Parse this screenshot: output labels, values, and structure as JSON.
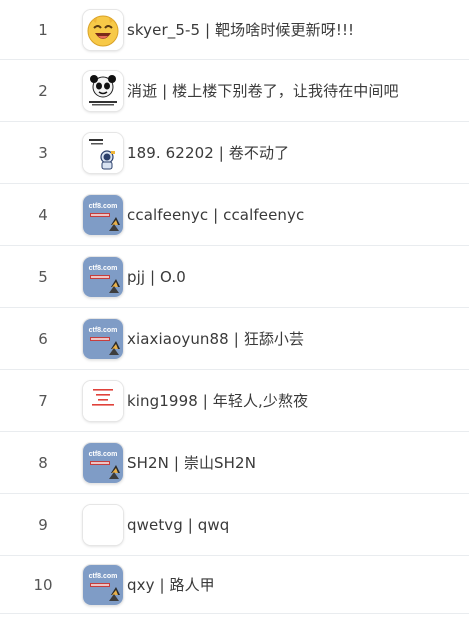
{
  "leaderboard": {
    "rows": [
      {
        "rank": "1",
        "entry": "skyer_5-5 | 靶场啥时候更新呀!!!",
        "avatar": "laughing-emoji-icon"
      },
      {
        "rank": "2",
        "entry": "消逝 | 楼上楼下别卷了，让我待在中间吧",
        "avatar": "panda-meme-icon"
      },
      {
        "rank": "3",
        "entry": "189.  62202 | 卷不动了",
        "avatar": "astronaut-cartoon-icon"
      },
      {
        "rank": "4",
        "entry": "ccalfeenyc | ccalfeenyc",
        "avatar": "ctf8-default-icon"
      },
      {
        "rank": "5",
        "entry": "pjj | O.0",
        "avatar": "ctf8-default-icon"
      },
      {
        "rank": "6",
        "entry": "xiaxiaoyun88 | 狂舔小芸",
        "avatar": "ctf8-default-icon"
      },
      {
        "rank": "7",
        "entry": "king1998 | 年轻人,少熬夜",
        "avatar": "red-text-note-icon"
      },
      {
        "rank": "8",
        "entry": "SH2N | 崇山SH2N",
        "avatar": "ctf8-default-icon"
      },
      {
        "rank": "9",
        "entry": "qwetvg | qwq",
        "avatar": "blank-avatar-icon"
      },
      {
        "rank": "10",
        "entry": "qxy | 路人甲",
        "avatar": "ctf8-default-icon"
      }
    ],
    "avatar_text": {
      "ctf8": "ctf8.com"
    },
    "colors": {
      "ctf8_bg": "#7f9cc6",
      "emoji_yellow": "#f7c948",
      "note_red": "#e0413a",
      "divider": "#e9ecef"
    }
  }
}
